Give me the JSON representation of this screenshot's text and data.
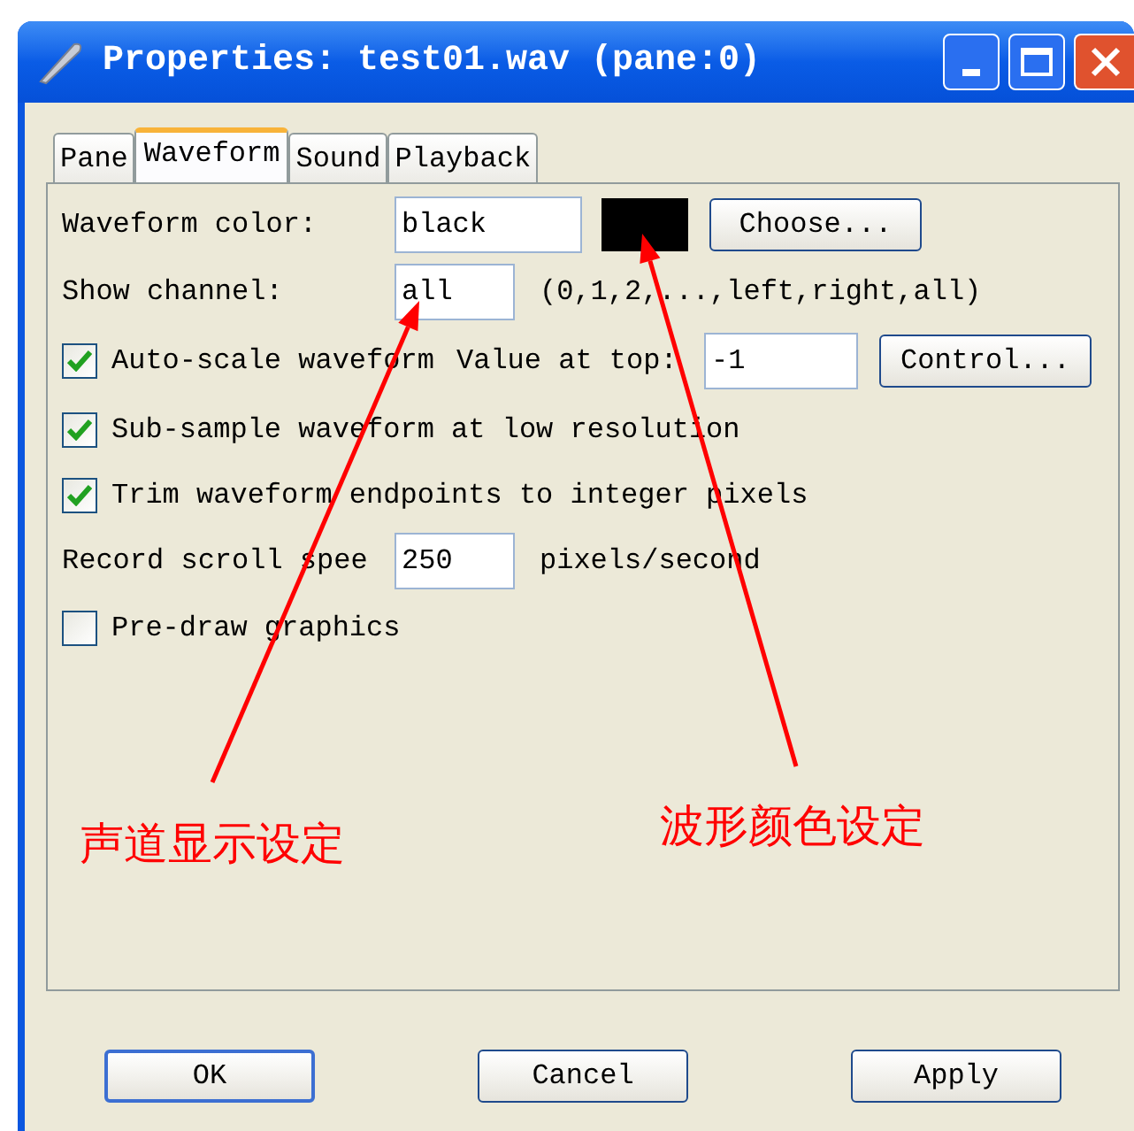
{
  "window": {
    "title": "Properties: test01.wav (pane:0)"
  },
  "tabs": [
    {
      "label": "Pane",
      "selected": false
    },
    {
      "label": "Waveform",
      "selected": true
    },
    {
      "label": "Sound",
      "selected": false
    },
    {
      "label": "Playback",
      "selected": false
    }
  ],
  "rows": [
    {
      "kind": "color",
      "label": "Waveform color:",
      "value": "black",
      "color": "#000000",
      "button": "Choose..."
    },
    {
      "kind": "text",
      "label": "Show channel:",
      "value": "all",
      "hint": "(0,1,2,...,left,right,all)"
    },
    {
      "kind": "check_value",
      "checked": true,
      "label": "Auto-scale waveform",
      "value_label": "Value at top:",
      "value": "-1",
      "button": "Control..."
    },
    {
      "kind": "check",
      "checked": true,
      "label": "Sub-sample waveform at low resolution"
    },
    {
      "kind": "check",
      "checked": true,
      "label": "Trim waveform endpoints to integer pixels"
    },
    {
      "kind": "text",
      "label": "Record scroll spee",
      "value": "250",
      "hint": "pixels/second"
    },
    {
      "kind": "check",
      "checked": false,
      "label": "Pre-draw graphics"
    }
  ],
  "buttons": [
    {
      "label": "OK",
      "default": true
    },
    {
      "label": "Cancel",
      "default": false
    },
    {
      "label": "Apply",
      "default": false
    }
  ],
  "annotations": [
    {
      "text": "声道显示设定"
    },
    {
      "text": "波形颜色设定"
    }
  ]
}
